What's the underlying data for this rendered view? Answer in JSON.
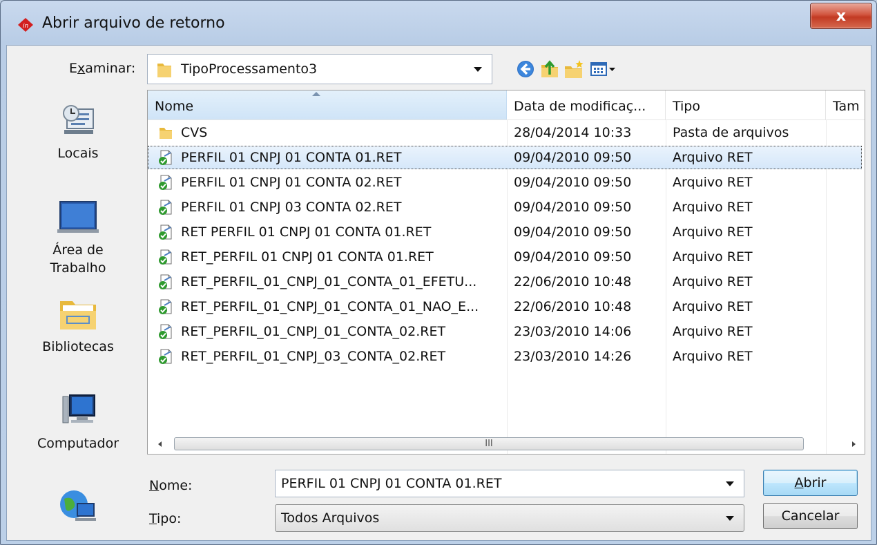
{
  "window": {
    "title": "Abrir arquivo de retorno",
    "close_glyph": "x",
    "accent": "#c23a23"
  },
  "lookin": {
    "label_pre": "E",
    "label_key": "x",
    "label_post": "aminar:",
    "value": "TipoProcessamento3"
  },
  "toolbar": {
    "icons": [
      "back-icon",
      "up-folder-icon",
      "new-folder-icon",
      "view-menu-icon"
    ]
  },
  "places": [
    {
      "label": "Locais",
      "icon": "recent-places-icon"
    },
    {
      "label": "Área de Trabalho",
      "icon": "desktop-icon"
    },
    {
      "label": "Bibliotecas",
      "icon": "libraries-icon"
    },
    {
      "label": "Computador",
      "icon": "computer-icon"
    },
    {
      "label": "",
      "icon": "network-icon"
    }
  ],
  "columns": {
    "name": "Nome",
    "date": "Data de modificaç...",
    "type": "Tipo",
    "size": "Tam"
  },
  "files": [
    {
      "name": "CVS",
      "date": "28/04/2014 10:33",
      "type": "Pasta de arquivos",
      "kind": "folder"
    },
    {
      "name": "PERFIL 01 CNPJ 01 CONTA 01.RET",
      "date": "09/04/2010 09:50",
      "type": "Arquivo RET",
      "kind": "file"
    },
    {
      "name": "PERFIL 01 CNPJ 01 CONTA 02.RET",
      "date": "09/04/2010 09:50",
      "type": "Arquivo RET",
      "kind": "file"
    },
    {
      "name": "PERFIL 01 CNPJ 03 CONTA 02.RET",
      "date": "09/04/2010 09:50",
      "type": "Arquivo RET",
      "kind": "file"
    },
    {
      "name": "RET PERFIL 01 CNPJ 01 CONTA 01.RET",
      "date": "09/04/2010 09:50",
      "type": "Arquivo RET",
      "kind": "file"
    },
    {
      "name": "RET_PERFIL 01 CNPJ 01 CONTA 01.RET",
      "date": "09/04/2010 09:50",
      "type": "Arquivo RET",
      "kind": "file"
    },
    {
      "name": "RET_PERFIL_01_CNPJ_01_CONTA_01_EFETU...",
      "date": "22/06/2010 10:48",
      "type": "Arquivo RET",
      "kind": "file"
    },
    {
      "name": "RET_PERFIL_01_CNPJ_01_CONTA_01_NAO_E...",
      "date": "22/06/2010 10:48",
      "type": "Arquivo RET",
      "kind": "file"
    },
    {
      "name": "RET_PERFIL_01_CNPJ_01_CONTA_02.RET",
      "date": "23/03/2010 14:06",
      "type": "Arquivo RET",
      "kind": "file"
    },
    {
      "name": "RET_PERFIL_01_CNPJ_03_CONTA_02.RET",
      "date": "23/03/2010 14:26",
      "type": "Arquivo RET",
      "kind": "file"
    }
  ],
  "selected_index": 1,
  "scrollbar": {
    "thumb_grip": "III"
  },
  "filename": {
    "label_key": "N",
    "label_post": "ome:",
    "value": "PERFIL 01 CNPJ 01 CONTA 01.RET"
  },
  "filetype": {
    "label_key": "T",
    "label_post": "ipo:",
    "value": "Todos Arquivos"
  },
  "buttons": {
    "open_key": "A",
    "open_post": "brir",
    "cancel": "Cancelar"
  }
}
